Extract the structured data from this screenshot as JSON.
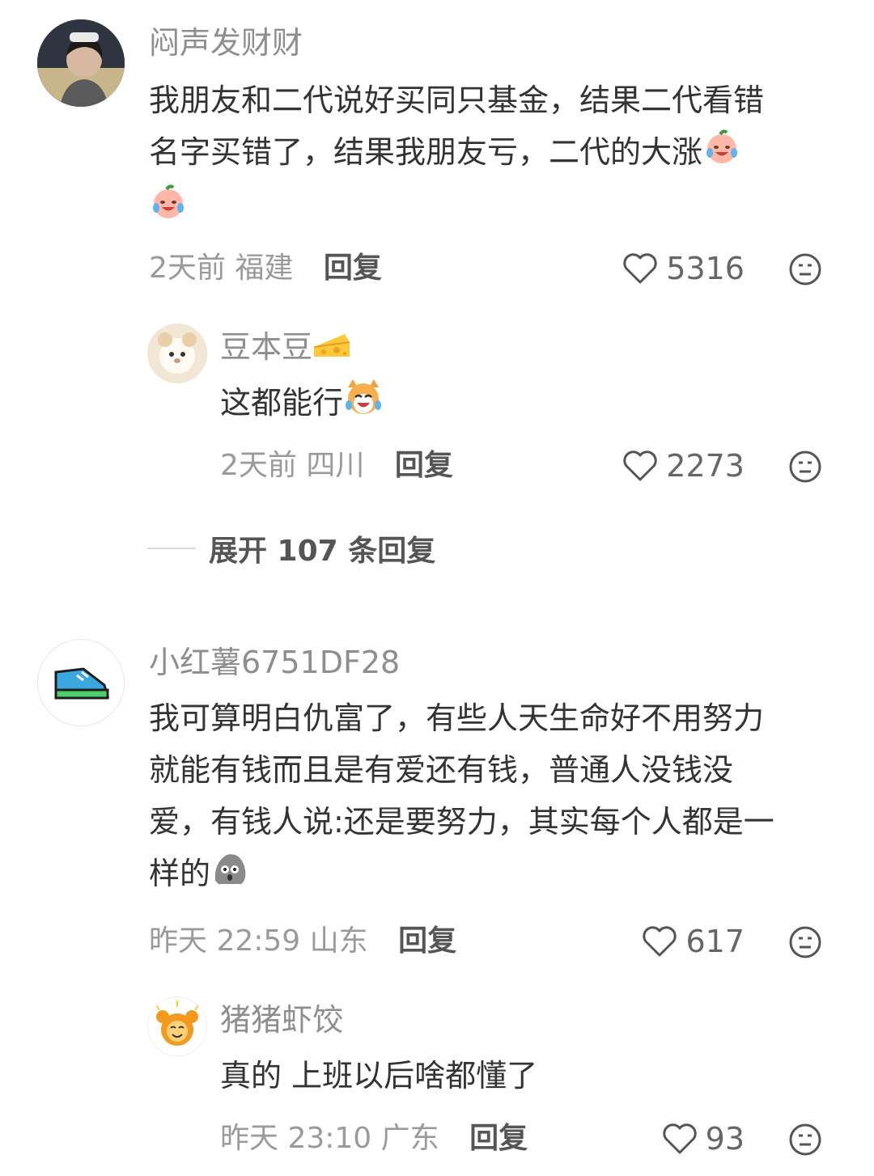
{
  "comments": [
    {
      "user": "闷声发财财",
      "text_1": "我朋友和二代说好买同只基金，结果二代看错",
      "text_2": "名字买错了，结果我朋友亏，二代的大涨",
      "time": "2天前",
      "location": "福建",
      "reply_label": "回复",
      "likes": "5316",
      "emoji": "crying-laughing-peach"
    },
    {
      "user": "小红薯6751DF28",
      "text_1": "我可算明白仇富了，有些人天生命好不用努力",
      "text_2": "就能有钱而且是有爱还有钱，普通人没钱没",
      "text_3": "爱，有钱人说:还是要努力，其实每个人都是一",
      "text_4": "样的",
      "time": "昨天 22:59",
      "location": "山东",
      "reply_label": "回复",
      "likes": "617",
      "emoji": "shocked-rock"
    }
  ],
  "replies": [
    {
      "user": "豆本豆",
      "badge": "cheese-icon",
      "text": "这都能行",
      "time": "2天前",
      "location": "四川",
      "reply_label": "回复",
      "likes": "2273",
      "emoji": "laughing-cat"
    },
    {
      "user": "猪猪虾饺",
      "text": "真的 上班以后啥都懂了",
      "time": "昨天 23:10",
      "location": "广东",
      "reply_label": "回复",
      "likes": "93"
    }
  ],
  "expand_label": "展开 107 条回复"
}
